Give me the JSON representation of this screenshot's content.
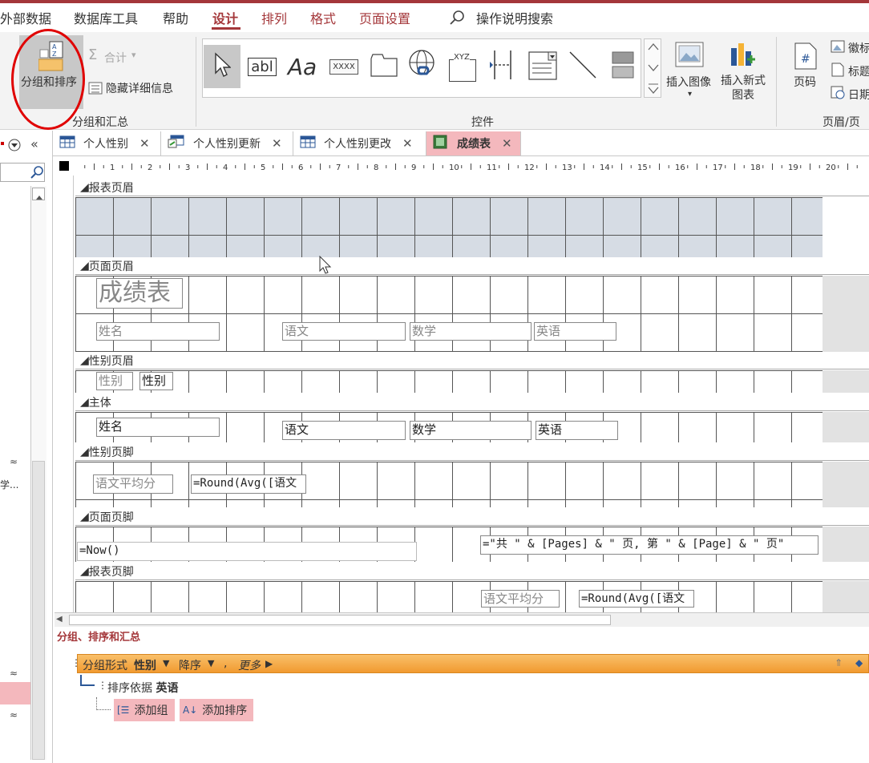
{
  "menu": {
    "tabs": [
      "外部数据",
      "数据库工具",
      "帮助",
      "设计",
      "排列",
      "格式",
      "页面设置"
    ],
    "search_label": "操作说明搜索"
  },
  "ribbon": {
    "group_sort": {
      "label": "分组和汇总",
      "group_sort_button": "分组和排序",
      "totals_button": "合计",
      "hide_details_button": "隐藏详细信息"
    },
    "controls_label": "控件",
    "insert_image": "插入图像",
    "insert_chart": "插入新式图表",
    "header_footer": {
      "label": "页眉/页脚",
      "page_number": "页码",
      "logo": "徽标",
      "title": "标题",
      "date_time": "日期"
    },
    "text_control": "abl",
    "label_control": "Aa",
    "button_control": "XXXX",
    "xyz_control": "XYZ"
  },
  "tabs": [
    {
      "label": "个人性别",
      "icon": "table-icon"
    },
    {
      "label": "个人性别更新",
      "icon": "query-icon"
    },
    {
      "label": "个人性别更改",
      "icon": "table-icon"
    },
    {
      "label": "成绩表",
      "icon": "report-icon",
      "active": true
    }
  ],
  "ruler_numbers": [
    "1",
    "2",
    "3",
    "4",
    "5",
    "6",
    "7",
    "8",
    "9",
    "10",
    "11",
    "12",
    "13",
    "14",
    "15",
    "16",
    "17",
    "18",
    "19",
    "20"
  ],
  "sections": {
    "report_header": "报表页眉",
    "page_header": "页面页眉",
    "group_header": "性别页眉",
    "detail": "主体",
    "group_footer": "性别页脚",
    "page_footer": "页面页脚",
    "report_footer": "报表页脚"
  },
  "controls": {
    "title": "成绩表",
    "name_label": "姓名",
    "chinese_label": "语文",
    "math_label": "数学",
    "english_label": "英语",
    "gender_label": "性别",
    "gender_field": "性别",
    "name_field": "姓名",
    "chinese_field": "语文",
    "math_field": "数学",
    "english_field": "英语",
    "avg_label": "语文平均分",
    "avg_expr": "=Round(Avg([语文",
    "now_expr": "=Now()",
    "page_expr": "=\"共 \" & [Pages] & \" 页, 第 \" & [Page] & \" 页\"",
    "report_avg_label": "语文平均分",
    "report_avg_expr": "=Round(Avg([语文"
  },
  "group_pane": {
    "title": "分组、排序和汇总",
    "group_row": {
      "prefix": "分组形式",
      "field": "性别",
      "order": "降序",
      "sep": ",",
      "more": "更多"
    },
    "sort_row": {
      "prefix": "排序依据",
      "field": "英语"
    },
    "add_group": "添加组",
    "add_sort": "添加排序"
  },
  "nav": {
    "truncated_text": "学..."
  },
  "colors": {
    "accent": "#a4373a",
    "group_bar": "#f7a840",
    "highlight": "#f4b8bd",
    "annotation_circle": "#e00000"
  }
}
